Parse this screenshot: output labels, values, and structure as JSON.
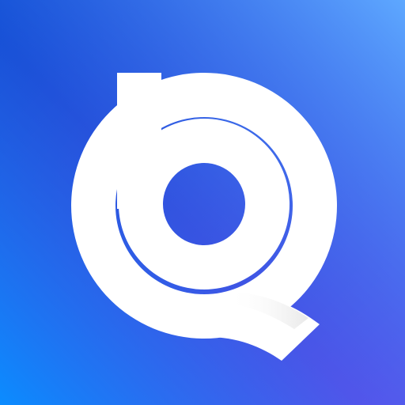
{
  "icon": {
    "name": "app-logo-icon",
    "colors": {
      "gradient_dark_blue": "#0743C8",
      "gradient_light_blue": "#5EA8FF",
      "gradient_mid_blue": "#2E6BEF",
      "gradient_bottom_left_blue": "#0B8CFF",
      "gradient_purple": "#6A4BEA",
      "glyph": "#FFFFFF",
      "glyph_shadow": "#E6E6E6"
    }
  }
}
